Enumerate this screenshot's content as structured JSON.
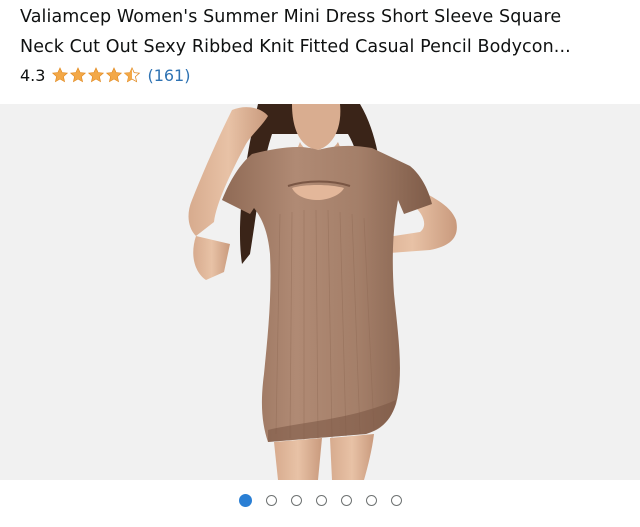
{
  "product": {
    "title_line1": "Valiamcep Women's Summer Mini Dress Short Sleeve Square",
    "title_line2": "Neck Cut Out Sexy Ribbed Knit Fitted Casual Pencil Bodycon...",
    "rating": "4.3",
    "stars": {
      "filled": 4,
      "half": 1,
      "empty": 0,
      "color": "#f3a847"
    },
    "review_count": "(161)"
  },
  "gallery": {
    "total_images": 7,
    "active_index": 0,
    "active_color": "#2a7fd4",
    "image_subject": "product-photo-brown-bodycon-dress"
  }
}
